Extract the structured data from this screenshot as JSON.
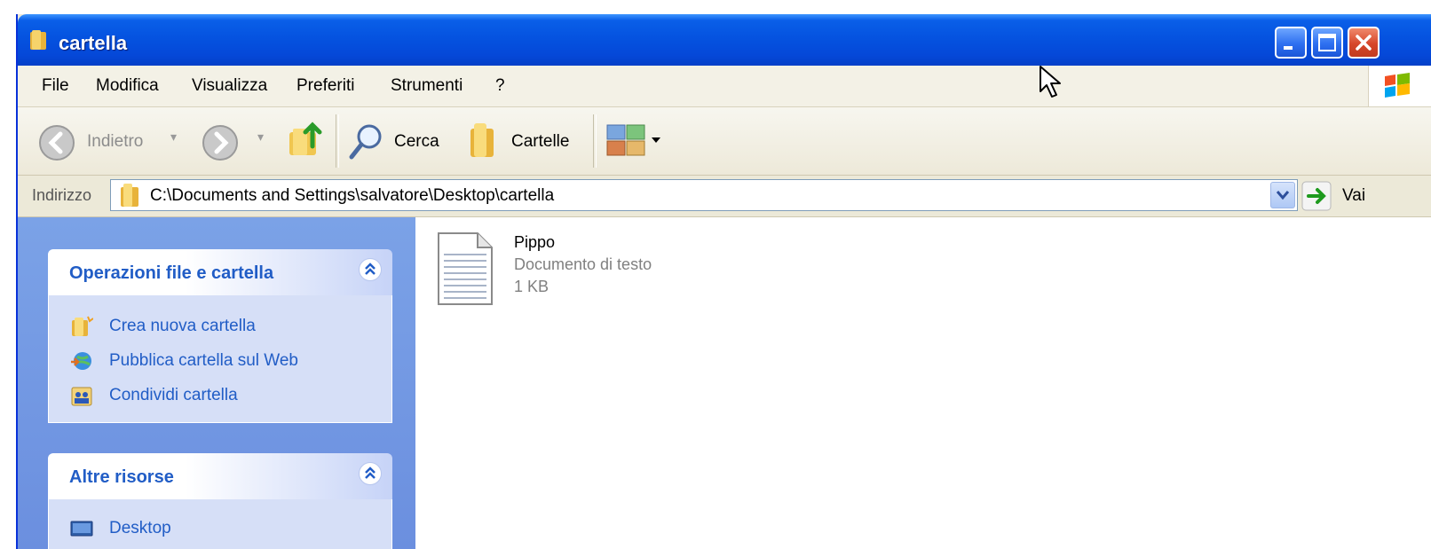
{
  "window": {
    "title": "cartella",
    "title_icon": "folder-icon",
    "controls": [
      "minimize",
      "maximize",
      "close"
    ]
  },
  "menubar": {
    "items": [
      "File",
      "Modifica",
      "Visualizza",
      "Preferiti",
      "Strumenti",
      "?"
    ]
  },
  "toolbar": {
    "back_label": "Indietro",
    "search_label": "Cerca",
    "folders_label": "Cartelle",
    "icons": {
      "back": "back-arrow-icon",
      "forward": "forward-arrow-icon",
      "up": "folder-up-icon",
      "search": "search-icon",
      "folders": "folders-icon",
      "views": "views-icon"
    }
  },
  "address": {
    "label": "Indirizzo",
    "path": "C:\\Documents and Settings\\salvatore\\Desktop\\cartella",
    "go_label": "Vai"
  },
  "taskpane": {
    "panels": [
      {
        "title": "Operazioni file e cartella",
        "items": [
          {
            "label": "Crea nuova cartella",
            "icon": "new-folder-icon"
          },
          {
            "label": "Pubblica cartella sul Web",
            "icon": "publish-web-icon"
          },
          {
            "label": "Condividi cartella",
            "icon": "share-folder-icon"
          }
        ]
      },
      {
        "title": "Altre risorse",
        "items": [
          {
            "label": "Desktop",
            "icon": "desktop-icon"
          }
        ]
      }
    ]
  },
  "files": [
    {
      "name": "Pippo",
      "type": "Documento di testo",
      "size": "1 KB",
      "icon": "text-document-icon"
    }
  ],
  "colors": {
    "titlebar": "#0553e0",
    "taskpane_bg": "#7ba2e7",
    "task_link": "#215dc6"
  }
}
